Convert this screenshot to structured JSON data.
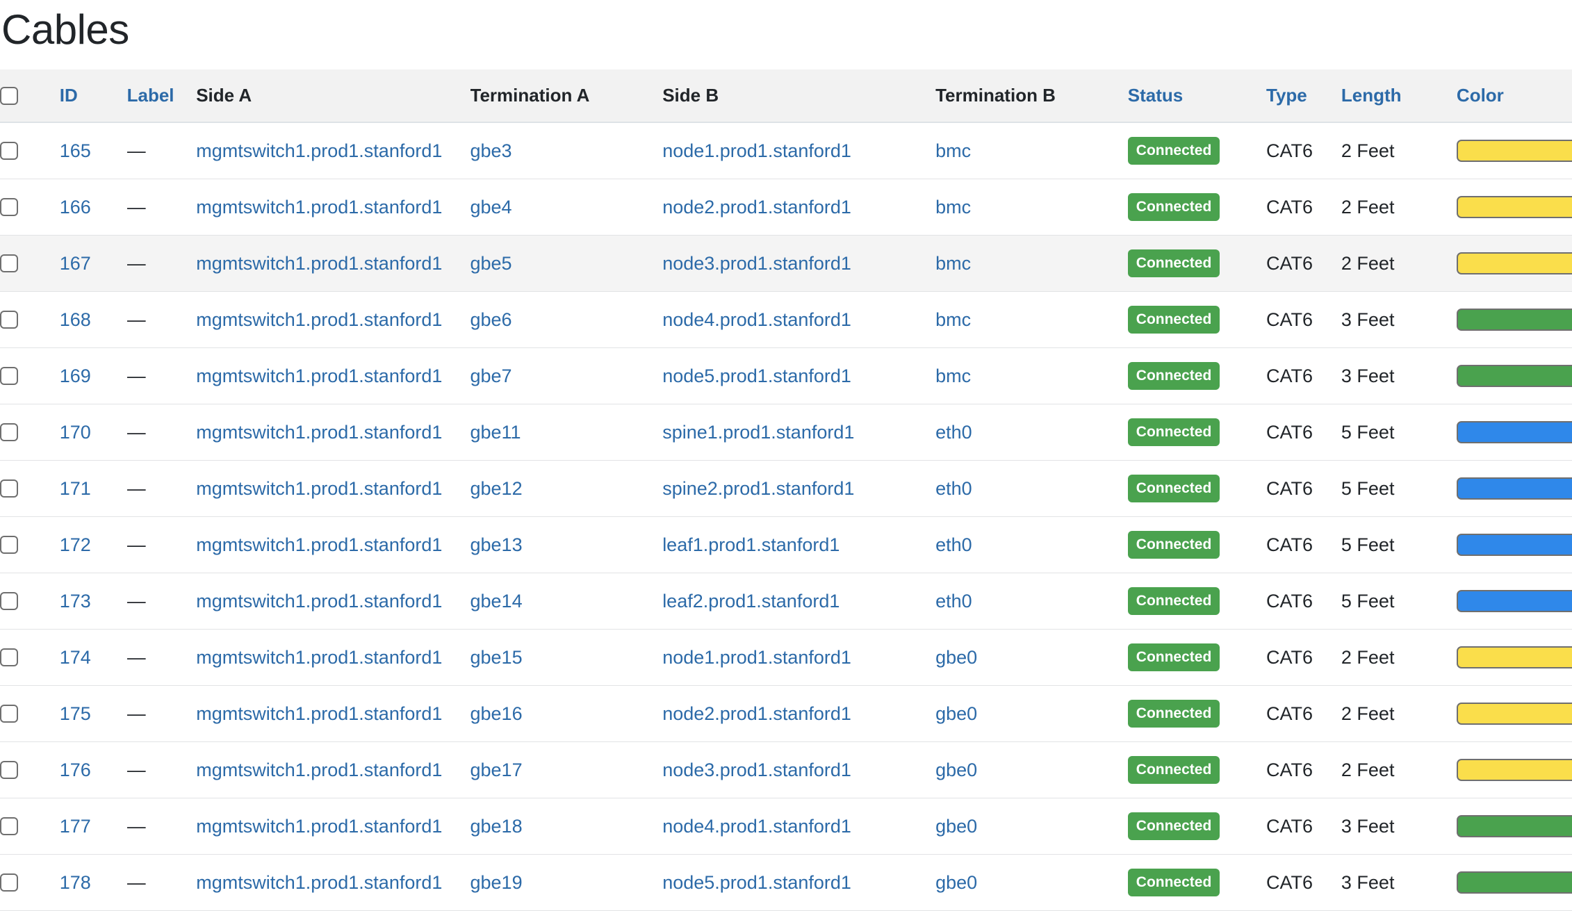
{
  "page": {
    "title": "Cables"
  },
  "table": {
    "select_all_checkbox": true,
    "columns": [
      {
        "key": "check",
        "label": "",
        "sortable": false
      },
      {
        "key": "id",
        "label": "ID",
        "sortable": true
      },
      {
        "key": "label",
        "label": "Label",
        "sortable": true
      },
      {
        "key": "side_a",
        "label": "Side A",
        "sortable": false
      },
      {
        "key": "term_a",
        "label": "Termination A",
        "sortable": false
      },
      {
        "key": "side_b",
        "label": "Side B",
        "sortable": false
      },
      {
        "key": "term_b",
        "label": "Termination B",
        "sortable": false
      },
      {
        "key": "status",
        "label": "Status",
        "sortable": true
      },
      {
        "key": "type",
        "label": "Type",
        "sortable": true
      },
      {
        "key": "length",
        "label": "Length",
        "sortable": true
      },
      {
        "key": "color",
        "label": "Color",
        "sortable": true
      }
    ],
    "colors": {
      "yellow": "#fade4b",
      "green": "#4aa24e",
      "blue": "#2f88ea",
      "swatch_border": "#6f6f6f",
      "link": "#2c6aa8",
      "badge_connected_bg": "#4aa24e",
      "header_bg": "#f2f2f2",
      "row_hover_bg": "#f4f4f4"
    },
    "rows": [
      {
        "id": "165",
        "label": "—",
        "side_a": "mgmtswitch1.prod1.stanford1",
        "term_a": "gbe3",
        "side_b": "node1.prod1.stanford1",
        "term_b": "bmc",
        "status": "Connected",
        "type": "CAT6",
        "length": "2 Feet",
        "color": "#fade4b",
        "color_name": "yellow",
        "hovered": false
      },
      {
        "id": "166",
        "label": "—",
        "side_a": "mgmtswitch1.prod1.stanford1",
        "term_a": "gbe4",
        "side_b": "node2.prod1.stanford1",
        "term_b": "bmc",
        "status": "Connected",
        "type": "CAT6",
        "length": "2 Feet",
        "color": "#fade4b",
        "color_name": "yellow",
        "hovered": false
      },
      {
        "id": "167",
        "label": "—",
        "side_a": "mgmtswitch1.prod1.stanford1",
        "term_a": "gbe5",
        "side_b": "node3.prod1.stanford1",
        "term_b": "bmc",
        "status": "Connected",
        "type": "CAT6",
        "length": "2 Feet",
        "color": "#fade4b",
        "color_name": "yellow",
        "hovered": true
      },
      {
        "id": "168",
        "label": "—",
        "side_a": "mgmtswitch1.prod1.stanford1",
        "term_a": "gbe6",
        "side_b": "node4.prod1.stanford1",
        "term_b": "bmc",
        "status": "Connected",
        "type": "CAT6",
        "length": "3 Feet",
        "color": "#4aa24e",
        "color_name": "green",
        "hovered": false
      },
      {
        "id": "169",
        "label": "—",
        "side_a": "mgmtswitch1.prod1.stanford1",
        "term_a": "gbe7",
        "side_b": "node5.prod1.stanford1",
        "term_b": "bmc",
        "status": "Connected",
        "type": "CAT6",
        "length": "3 Feet",
        "color": "#4aa24e",
        "color_name": "green",
        "hovered": false
      },
      {
        "id": "170",
        "label": "—",
        "side_a": "mgmtswitch1.prod1.stanford1",
        "term_a": "gbe11",
        "side_b": "spine1.prod1.stanford1",
        "term_b": "eth0",
        "status": "Connected",
        "type": "CAT6",
        "length": "5 Feet",
        "color": "#2f88ea",
        "color_name": "blue",
        "hovered": false
      },
      {
        "id": "171",
        "label": "—",
        "side_a": "mgmtswitch1.prod1.stanford1",
        "term_a": "gbe12",
        "side_b": "spine2.prod1.stanford1",
        "term_b": "eth0",
        "status": "Connected",
        "type": "CAT6",
        "length": "5 Feet",
        "color": "#2f88ea",
        "color_name": "blue",
        "hovered": false
      },
      {
        "id": "172",
        "label": "—",
        "side_a": "mgmtswitch1.prod1.stanford1",
        "term_a": "gbe13",
        "side_b": "leaf1.prod1.stanford1",
        "term_b": "eth0",
        "status": "Connected",
        "type": "CAT6",
        "length": "5 Feet",
        "color": "#2f88ea",
        "color_name": "blue",
        "hovered": false
      },
      {
        "id": "173",
        "label": "—",
        "side_a": "mgmtswitch1.prod1.stanford1",
        "term_a": "gbe14",
        "side_b": "leaf2.prod1.stanford1",
        "term_b": "eth0",
        "status": "Connected",
        "type": "CAT6",
        "length": "5 Feet",
        "color": "#2f88ea",
        "color_name": "blue",
        "hovered": false
      },
      {
        "id": "174",
        "label": "—",
        "side_a": "mgmtswitch1.prod1.stanford1",
        "term_a": "gbe15",
        "side_b": "node1.prod1.stanford1",
        "term_b": "gbe0",
        "status": "Connected",
        "type": "CAT6",
        "length": "2 Feet",
        "color": "#fade4b",
        "color_name": "yellow",
        "hovered": false
      },
      {
        "id": "175",
        "label": "—",
        "side_a": "mgmtswitch1.prod1.stanford1",
        "term_a": "gbe16",
        "side_b": "node2.prod1.stanford1",
        "term_b": "gbe0",
        "status": "Connected",
        "type": "CAT6",
        "length": "2 Feet",
        "color": "#fade4b",
        "color_name": "yellow",
        "hovered": false
      },
      {
        "id": "176",
        "label": "—",
        "side_a": "mgmtswitch1.prod1.stanford1",
        "term_a": "gbe17",
        "side_b": "node3.prod1.stanford1",
        "term_b": "gbe0",
        "status": "Connected",
        "type": "CAT6",
        "length": "2 Feet",
        "color": "#fade4b",
        "color_name": "yellow",
        "hovered": false
      },
      {
        "id": "177",
        "label": "—",
        "side_a": "mgmtswitch1.prod1.stanford1",
        "term_a": "gbe18",
        "side_b": "node4.prod1.stanford1",
        "term_b": "gbe0",
        "status": "Connected",
        "type": "CAT6",
        "length": "3 Feet",
        "color": "#4aa24e",
        "color_name": "green",
        "hovered": false
      },
      {
        "id": "178",
        "label": "—",
        "side_a": "mgmtswitch1.prod1.stanford1",
        "term_a": "gbe19",
        "side_b": "node5.prod1.stanford1",
        "term_b": "gbe0",
        "status": "Connected",
        "type": "CAT6",
        "length": "3 Feet",
        "color": "#4aa24e",
        "color_name": "green",
        "hovered": false
      }
    ]
  }
}
